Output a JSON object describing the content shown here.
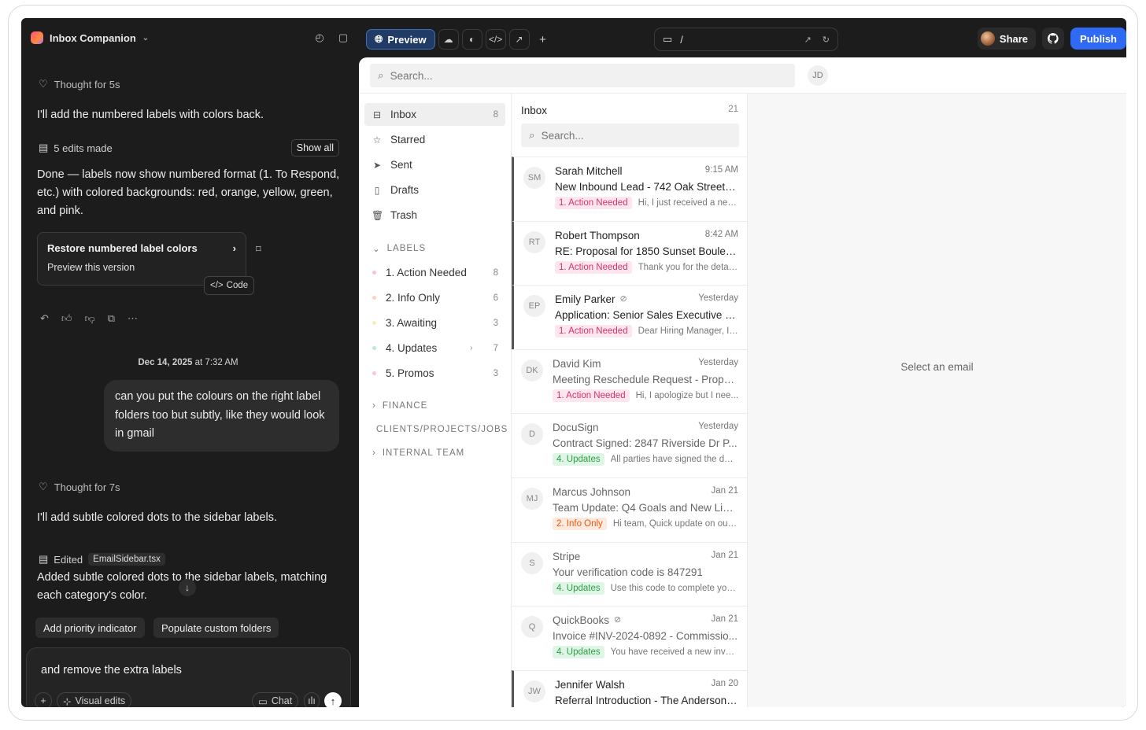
{
  "topbar": {
    "project": "Inbox Companion",
    "preview_label": "Preview",
    "url_path": "/",
    "share_label": "Share",
    "publish_label": "Publish"
  },
  "chat": {
    "thought1": "Thought for 5s",
    "msg1": "I'll add the numbered labels with colors back.",
    "edits_made": "5 edits made",
    "show_all": "Show all",
    "msg2": "Done — labels now show numbered format (1. To Respond, etc.) with colored backgrounds: red, orange, yellow, green, and pink.",
    "restore_title": "Restore numbered label colors",
    "restore_sub": "Preview this version",
    "code_badge": "Code",
    "date": "Dec 14, 2025",
    "time": "at 7:32 AM",
    "user_msg": "can you put the colours on the right label folders too but subtly, like they would look in gmail",
    "thought2": "Thought for 7s",
    "msg3": "I'll add subtle colored dots to the sidebar labels.",
    "edited_label": "Edited",
    "edited_file": "EmailSidebar.tsx",
    "msg4": "Added subtle colored dots to the sidebar labels, matching each category's color.",
    "suggestions": [
      "Add priority indicator",
      "Populate custom folders"
    ],
    "composer_text": "and remove the extra labels",
    "visual_edits": "Visual edits",
    "chat_btn": "Chat"
  },
  "email": {
    "search_placeholder": "Search...",
    "user_initials": "JD",
    "nav": [
      {
        "label": "Inbox",
        "count": "8",
        "icon": "inbox-icon"
      },
      {
        "label": "Starred",
        "count": "",
        "icon": "star-icon"
      },
      {
        "label": "Sent",
        "count": "",
        "icon": "send-icon"
      },
      {
        "label": "Drafts",
        "count": "",
        "icon": "file-icon"
      },
      {
        "label": "Trash",
        "count": "",
        "icon": "trash-icon"
      }
    ],
    "labels_heading": "LABELS",
    "labels": [
      {
        "name": "1. Action Needed",
        "count": "8",
        "color": "#f6c1d3"
      },
      {
        "name": "2. Info Only",
        "count": "6",
        "color": "#fbd2bf"
      },
      {
        "name": "3. Awaiting",
        "count": "3",
        "color": "#faeab5"
      },
      {
        "name": "4. Updates",
        "count": "7",
        "color": "#bfe8cf"
      },
      {
        "name": "5. Promos",
        "count": "3",
        "color": "#f7c6d7"
      }
    ],
    "folders": [
      "FINANCE",
      "CLIENTS/PROJECTS/JOBS",
      "INTERNAL TEAM"
    ],
    "list_title": "Inbox",
    "list_count": "21",
    "list_search_placeholder": "Search...",
    "empty_state": "Select an email",
    "messages": [
      {
        "initials": "SM",
        "from": "Sarah Mitchell",
        "time": "9:15 AM",
        "subject": "New Inbound Lead - 742 Oak Street P...",
        "tag": "1. Action Needed",
        "tag_type": "action",
        "snippet": "Hi, I just received a new ...",
        "unread": true,
        "attachment": false
      },
      {
        "initials": "RT",
        "from": "Robert Thompson",
        "time": "8:42 AM",
        "subject": "RE: Proposal for 1850 Sunset Boulevard",
        "tag": "1. Action Needed",
        "tag_type": "action",
        "snippet": "Thank you for the detail...",
        "unread": true,
        "attachment": false
      },
      {
        "initials": "EP",
        "from": "Emily Parker",
        "time": "Yesterday",
        "subject": "Application: Senior Sales Executive P...",
        "tag": "1. Action Needed",
        "tag_type": "action",
        "snippet": "Dear Hiring Manager, I a...",
        "unread": true,
        "attachment": true
      },
      {
        "initials": "DK",
        "from": "David Kim",
        "time": "Yesterday",
        "subject": "Meeting Reschedule Request - Proper...",
        "tag": "1. Action Needed",
        "tag_type": "action",
        "snippet": "Hi, I apologize but I nee...",
        "unread": false,
        "attachment": false
      },
      {
        "initials": "D",
        "from": "DocuSign",
        "time": "Yesterday",
        "subject": "Contract Signed: 2847 Riverside Dr P...",
        "tag": "4. Updates",
        "tag_type": "updates",
        "snippet": "All parties have signed the doc...",
        "unread": false,
        "attachment": false
      },
      {
        "initials": "MJ",
        "from": "Marcus Johnson",
        "time": "Jan 21",
        "subject": "Team Update: Q4 Goals and New Listi...",
        "tag": "2. Info Only",
        "tag_type": "info",
        "snippet": "Hi team, Quick update on our ...",
        "unread": false,
        "attachment": false
      },
      {
        "initials": "S",
        "from": "Stripe",
        "time": "Jan 21",
        "subject": "Your verification code is 847291",
        "tag": "4. Updates",
        "tag_type": "updates",
        "snippet": "Use this code to complete your...",
        "unread": false,
        "attachment": false
      },
      {
        "initials": "Q",
        "from": "QuickBooks",
        "time": "Jan 21",
        "subject": "Invoice #INV-2024-0892 - Commissio...",
        "tag": "4. Updates",
        "tag_type": "updates",
        "snippet": "You have received a new invoi...",
        "unread": false,
        "attachment": true
      },
      {
        "initials": "JW",
        "from": "Jennifer Walsh",
        "time": "Jan 20",
        "subject": "Referral Introduction - The Anderson F...",
        "tag": "",
        "tag_type": "",
        "snippet": "",
        "unread": true,
        "attachment": false
      }
    ]
  },
  "colors": {
    "accent": "#2f6af5",
    "action_bg": "#fde6ee",
    "action_fg": "#d6336c",
    "info_bg": "#fde9dd",
    "info_fg": "#e8590c",
    "updates_bg": "#dff6e7",
    "updates_fg": "#2f9e44"
  }
}
